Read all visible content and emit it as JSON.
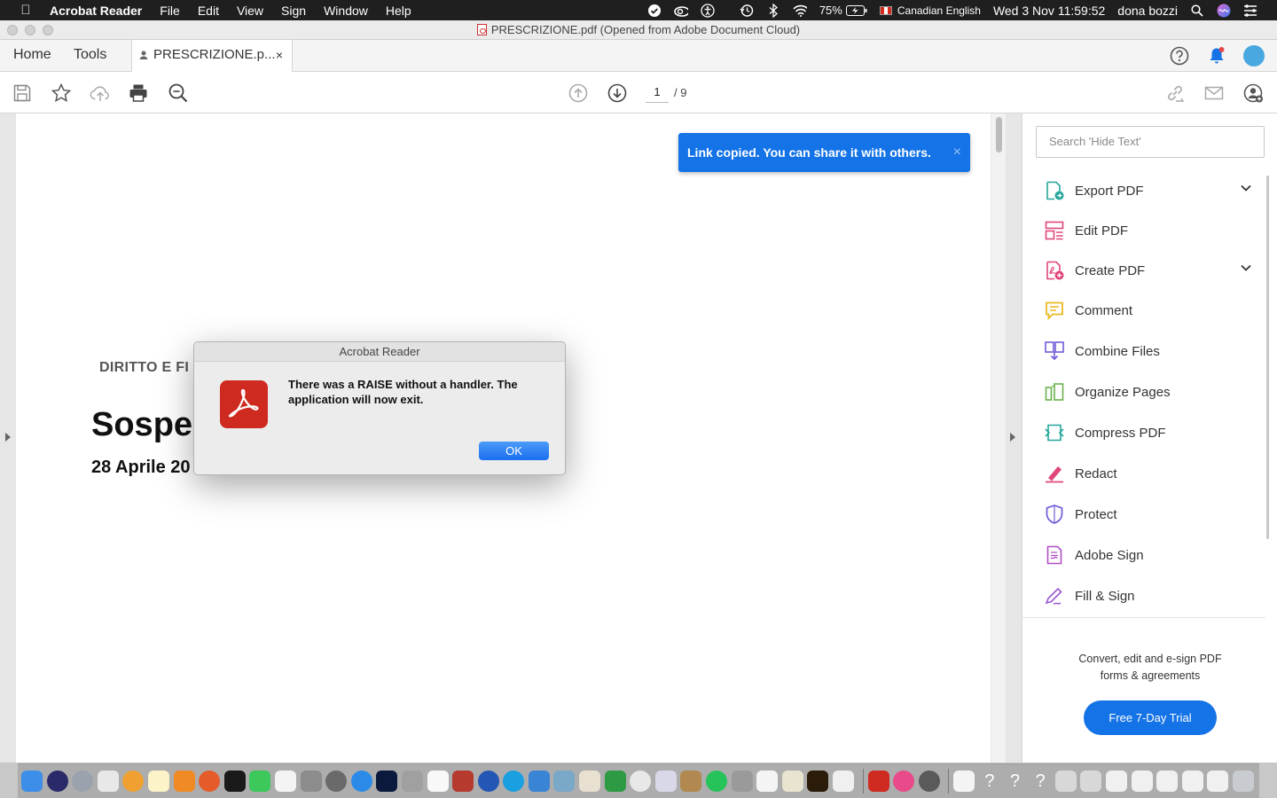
{
  "menubar": {
    "app_name": "Acrobat Reader",
    "menus": [
      "File",
      "Edit",
      "View",
      "Sign",
      "Window",
      "Help"
    ],
    "battery": "75%",
    "input_source": "Canadian English",
    "datetime": "Wed 3 Nov  11:59:52",
    "user": "dona bozzi"
  },
  "window": {
    "title": "PRESCRIZIONE.pdf (Opened from Adobe Document Cloud)"
  },
  "tabs": {
    "home": "Home",
    "tools": "Tools",
    "document": "PRESCRIZIONE.p...",
    "close": "×"
  },
  "toolbar": {
    "current_page": "1",
    "total_pages": "/ 9"
  },
  "document": {
    "category": "DIRITTO E FI",
    "title": "Sospe                                         ne: come funziona?",
    "date": "28 Aprile 20"
  },
  "toast": {
    "message": "Link copied. You can share it with others.",
    "close": "×"
  },
  "right_panel": {
    "search_placeholder": "Search 'Hide Text'",
    "tools": [
      {
        "label": "Export PDF",
        "icon": "export-pdf-icon",
        "color": "#26a69a",
        "expandable": true
      },
      {
        "label": "Edit PDF",
        "icon": "edit-pdf-icon",
        "color": "#e0457b",
        "expandable": false
      },
      {
        "label": "Create PDF",
        "icon": "create-pdf-icon",
        "color": "#e0457b",
        "expandable": true
      },
      {
        "label": "Comment",
        "icon": "comment-icon",
        "color": "#e8b923",
        "expandable": false
      },
      {
        "label": "Combine Files",
        "icon": "combine-files-icon",
        "color": "#6f5bd9",
        "expandable": false
      },
      {
        "label": "Organize Pages",
        "icon": "organize-pages-icon",
        "color": "#6ab04c",
        "expandable": false
      },
      {
        "label": "Compress PDF",
        "icon": "compress-pdf-icon",
        "color": "#26a69a",
        "expandable": false
      },
      {
        "label": "Redact",
        "icon": "redact-icon",
        "color": "#e0457b",
        "expandable": false
      },
      {
        "label": "Protect",
        "icon": "protect-icon",
        "color": "#6f5bd9",
        "expandable": false
      },
      {
        "label": "Adobe Sign",
        "icon": "adobe-sign-icon",
        "color": "#b04fc4",
        "expandable": false
      },
      {
        "label": "Fill & Sign",
        "icon": "fill-sign-icon",
        "color": "#9b59d0",
        "expandable": false
      }
    ],
    "promo_line1": "Convert, edit and e-sign PDF",
    "promo_line2": "forms & agreements",
    "trial_button": "Free 7-Day Trial"
  },
  "dialog": {
    "title": "Acrobat Reader",
    "message": "There was a RAISE without a handler. The application will now exit.",
    "ok": "OK"
  },
  "colors": {
    "accent": "#1473e6",
    "acrobat_red": "#cf2a20"
  }
}
